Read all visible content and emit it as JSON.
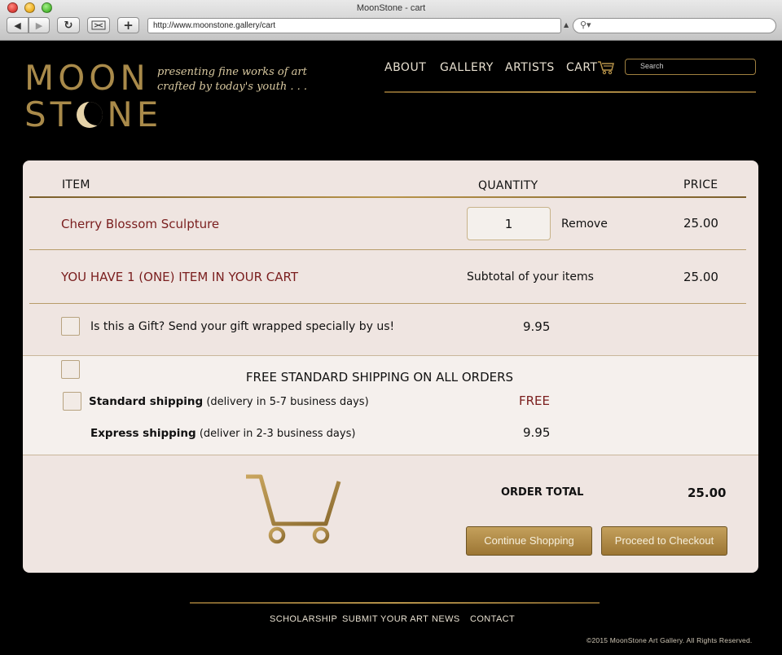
{
  "window": {
    "title": "MoonStone - cart"
  },
  "browser": {
    "url": "http://www.moonstone.gallery/cart",
    "search_icon": "magnifier-icon"
  },
  "brand": {
    "logo_top": "MOON",
    "logo_bottom_left": "ST",
    "logo_bottom_right": "NE",
    "tagline_line1": "presenting fine works of art",
    "tagline_line2": "crafted by today's youth  . . .",
    "gold": "#a98a4a"
  },
  "nav": {
    "about": "ABOUT",
    "gallery": "GALLERY",
    "artists": "ARTISTS",
    "cart": "CART",
    "search_placeholder": "Search"
  },
  "cart": {
    "headers": {
      "item": "ITEM",
      "quantity": "QUANTITY",
      "price": "PRICE"
    },
    "items": [
      {
        "name": "Cherry Blossom Sculpture",
        "quantity": "1",
        "remove": "Remove",
        "price": "25.00"
      }
    ],
    "count_message": "YOU HAVE 1 (ONE) ITEM IN YOUR CART",
    "subtotal_label": "Subtotal of your items",
    "subtotal": "25.00",
    "gift": {
      "label": "Is this a Gift? Send your gift wrapped specially by us!",
      "price": "9.95",
      "checked": false
    },
    "shipping": {
      "heading": "FREE STANDARD SHIPPING ON ALL ORDERS",
      "standard": {
        "title": "Standard shipping",
        "detail": "(delivery in 5-7 business days)",
        "price": "FREE",
        "checked": false
      },
      "express": {
        "title": "Express shipping",
        "detail": "(deliver in 2-3 business days)",
        "price": "9.95",
        "checked": false
      }
    },
    "order_total_label": "ORDER TOTAL",
    "order_total": "25.00",
    "continue_button": "Continue Shopping",
    "checkout_button": "Proceed to Checkout",
    "accent_red": "#7a1e1e"
  },
  "footer": {
    "links": [
      "SCHOLARSHIP",
      "SUBMIT YOUR ART",
      "NEWS",
      "CONTACT"
    ],
    "copyright": "©2015 MoonStone Art Gallery. All Rights Reserved."
  }
}
